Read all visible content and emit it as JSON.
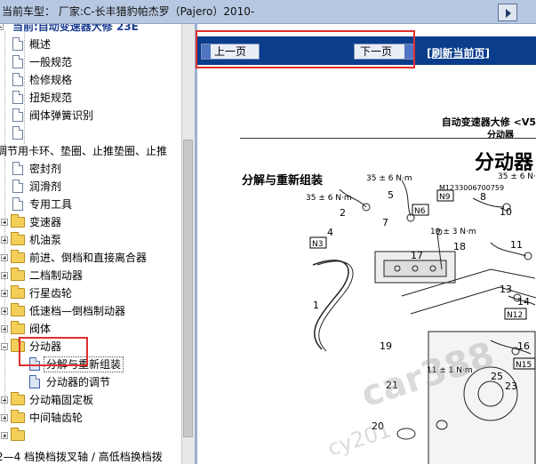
{
  "window_title": "当前车型：  厂家:C-长丰猎豹帕杰罗（Pajero）2010-",
  "tree": {
    "items": [
      {
        "label": "当前:自动变速器大修 23E",
        "kind": "folder-open"
      },
      {
        "label": "概述",
        "kind": "doc"
      },
      {
        "label": "一般规范",
        "kind": "doc"
      },
      {
        "label": "检修规格",
        "kind": "doc"
      },
      {
        "label": "扭矩规范",
        "kind": "doc"
      },
      {
        "label": "阀体弹簧识别",
        "kind": "doc"
      },
      {
        "label": "",
        "kind": "doc"
      },
      {
        "label": "调节用卡环、垫圈、止推垫圈、止推",
        "kind": "text"
      },
      {
        "label": "密封剂",
        "kind": "doc"
      },
      {
        "label": "润滑剂",
        "kind": "doc"
      },
      {
        "label": "专用工具",
        "kind": "doc"
      },
      {
        "label": "变速器",
        "kind": "folder"
      },
      {
        "label": "机油泵",
        "kind": "folder"
      },
      {
        "label": "前进、倒档和直接离合器",
        "kind": "folder"
      },
      {
        "label": "二档制动器",
        "kind": "folder"
      },
      {
        "label": "行星齿轮",
        "kind": "folder"
      },
      {
        "label": "低速档—倒档制动器",
        "kind": "folder"
      },
      {
        "label": "阀体",
        "kind": "folder"
      },
      {
        "label": "分动器",
        "kind": "folder-open"
      },
      {
        "label": "分解与重新组装",
        "kind": "doc-selected"
      },
      {
        "label": "分动器的调节",
        "kind": "doc-sub"
      },
      {
        "label": "分动箱固定板",
        "kind": "folder"
      },
      {
        "label": "中间轴齿轮",
        "kind": "folder"
      },
      {
        "label": "",
        "kind": "folder"
      },
      {
        "label": "2—4 档换档拨叉轴 / 高低档换档拨",
        "kind": "text"
      }
    ]
  },
  "nav": {
    "prev_label": "上一页",
    "next_label": "下一页",
    "refresh_label": "[刷新当前页]"
  },
  "document": {
    "header": "自动变速器大修 <V5",
    "subheader": "分动器",
    "title": "分动器",
    "section": "分解与重新组装",
    "figure_code": "M1233006700759",
    "torque_1": "35 ± 6 N·m",
    "torque_2": "35 ± 6 N·m",
    "torque_3": "35 ± 6 N·m",
    "torque_4": "35 ± 6 N·m",
    "torque_5": "19 ± 3 N·m",
    "torque_6": "11 ± 1 N·m",
    "callouts": [
      "1",
      "2",
      "3",
      "4",
      "5",
      "6",
      "7",
      "8",
      "9",
      "10",
      "11",
      "12",
      "13",
      "14",
      "15",
      "16",
      "17",
      "18",
      "19",
      "21",
      "23",
      "25",
      "20"
    ],
    "n_marks": [
      "N3",
      "N6",
      "N9",
      "N3",
      "N12",
      "N15"
    ]
  },
  "watermark": {
    "text_1": "car388",
    "text_2": "cy201",
    "text_3": "car388.com"
  },
  "colors": {
    "navbar": "#0a3d8c",
    "highlight_box": "#e03030",
    "topbar": "#b7c8e2"
  }
}
